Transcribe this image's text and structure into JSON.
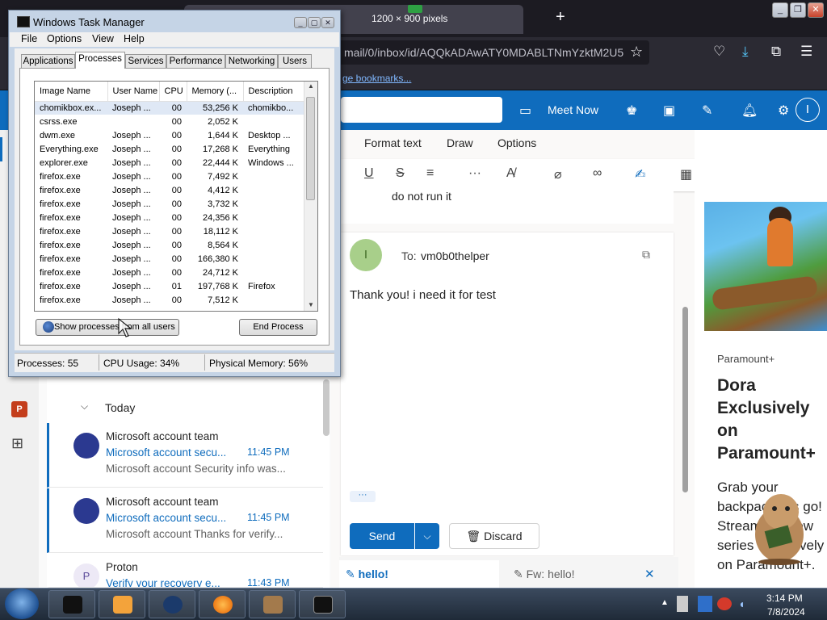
{
  "firefox": {
    "tab_title": "1200 × 900 pixels",
    "new_tab_glyph": "+",
    "url": "mail/0/inbox/id/AQQkADAwATY0MDABLTNmYzktM2U5",
    "bookmarks_link": "ge bookmarks...",
    "window_controls": [
      "_",
      "❐",
      "✕"
    ]
  },
  "outlook": {
    "header": {
      "meet_now": "Meet Now",
      "avatar_initial": "I"
    },
    "ribbon_tabs": [
      "Format text",
      "Draw",
      "Options"
    ],
    "previous_message_text": "do not run it",
    "compose": {
      "avatar_initial": "I",
      "to_label": "To:",
      "to_value": "vm0b0thelper",
      "body": "Thank you! i need it for test",
      "more_dots": "···",
      "send_label": "Send",
      "discard_label": "Discard"
    },
    "drafts": {
      "tab1": "hello!",
      "tab2": "Fw: hello!"
    },
    "message_list": {
      "group_label": "Today",
      "messages": [
        {
          "sender": "Microsoft account team",
          "subject": "Microsoft account secu...",
          "time": "11:45 PM",
          "preview": "Microsoft account Security info was..."
        },
        {
          "sender": "Microsoft account team",
          "subject": "Microsoft account secu...",
          "time": "11:45 PM",
          "preview": "Microsoft account Thanks for verify..."
        },
        {
          "sender": "Proton",
          "subject": "Verify your recovery e...",
          "time": "11:43 PM",
          "preview": "",
          "avatar_initial": "P"
        }
      ]
    },
    "ad": {
      "brand": "Paramount+",
      "title": "Dora Exclusively on Paramount+",
      "description": "Grab your backpack, it's go! Stream the new series exclusively on Paramount+."
    }
  },
  "task_manager": {
    "title": "Windows Task Manager",
    "menu": [
      "File",
      "Options",
      "View",
      "Help"
    ],
    "tabs": [
      "Applications",
      "Processes",
      "Services",
      "Performance",
      "Networking",
      "Users"
    ],
    "active_tab": "Processes",
    "columns": [
      "Image Name",
      "User Name",
      "CPU",
      "Memory (...",
      "Description"
    ],
    "rows": [
      [
        "chomikbox.ex...",
        "Joseph ...",
        "00",
        "53,256 K",
        "chomikbo..."
      ],
      [
        "csrss.exe",
        "",
        "00",
        "2,052 K",
        ""
      ],
      [
        "dwm.exe",
        "Joseph ...",
        "00",
        "1,644 K",
        "Desktop ..."
      ],
      [
        "Everything.exe",
        "Joseph ...",
        "00",
        "17,268 K",
        "Everything"
      ],
      [
        "explorer.exe",
        "Joseph ...",
        "00",
        "22,444 K",
        "Windows ..."
      ],
      [
        "firefox.exe",
        "Joseph ...",
        "00",
        "7,492 K",
        ""
      ],
      [
        "firefox.exe",
        "Joseph ...",
        "00",
        "4,412 K",
        ""
      ],
      [
        "firefox.exe",
        "Joseph ...",
        "00",
        "3,732 K",
        ""
      ],
      [
        "firefox.exe",
        "Joseph ...",
        "00",
        "24,356 K",
        ""
      ],
      [
        "firefox.exe",
        "Joseph ...",
        "00",
        "18,112 K",
        ""
      ],
      [
        "firefox.exe",
        "Joseph ...",
        "00",
        "8,564 K",
        ""
      ],
      [
        "firefox.exe",
        "Joseph ...",
        "00",
        "166,380 K",
        ""
      ],
      [
        "firefox.exe",
        "Joseph ...",
        "00",
        "24,712 K",
        ""
      ],
      [
        "firefox.exe",
        "Joseph ...",
        "01",
        "197,768 K",
        "Firefox"
      ],
      [
        "firefox.exe",
        "Joseph ...",
        "00",
        "7,512 K",
        ""
      ]
    ],
    "show_all_label": "Show processes from all users",
    "end_process_label": "End Process",
    "status": {
      "processes": "Processes: 55",
      "cpu": "CPU Usage: 34%",
      "memory": "Physical Memory: 56%"
    }
  },
  "taskbar": {
    "time": "3:14 PM",
    "date": "7/8/2024"
  }
}
